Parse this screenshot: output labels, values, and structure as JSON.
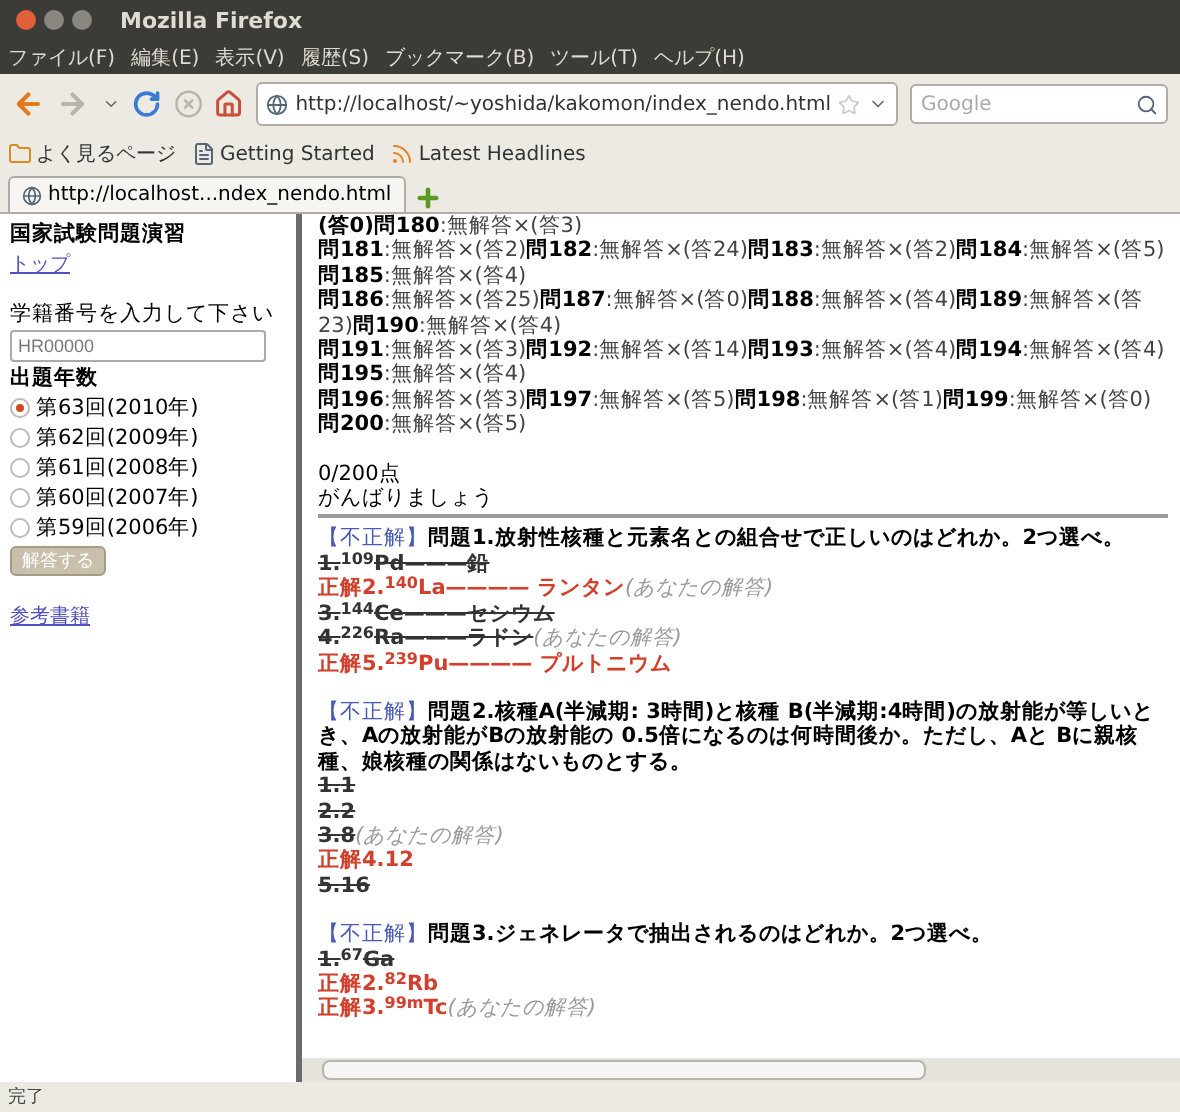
{
  "window": {
    "title": "Mozilla Firefox"
  },
  "menu": [
    "ファイル(F)",
    "編集(E)",
    "表示(V)",
    "履歴(S)",
    "ブックマーク(B)",
    "ツール(T)",
    "ヘルプ(H)"
  ],
  "navigation": {
    "url": "http://localhost/~yoshida/kakomon/index_nendo.html",
    "search_placeholder": "Google"
  },
  "bookmarks": [
    {
      "label": "よく見るページ",
      "kind": "folder"
    },
    {
      "label": "Getting Started",
      "kind": "page"
    },
    {
      "label": "Latest Headlines",
      "kind": "feed"
    }
  ],
  "tabs": [
    {
      "label": "http://localhost...ndex_nendo.html",
      "selected": true
    }
  ],
  "sidebar": {
    "title": "国家試験問題演習",
    "top_link": "トップ",
    "id_prompt": "学籍番号を入力して下さい",
    "id_value": "HR00000",
    "years_heading": "出題年数",
    "years": [
      {
        "label": "第63回(2010年)",
        "selected": true
      },
      {
        "label": "第62回(2009年)",
        "selected": false
      },
      {
        "label": "第61回(2008年)",
        "selected": false
      },
      {
        "label": "第60回(2007年)",
        "selected": false
      },
      {
        "label": "第59回(2006年)",
        "selected": false
      }
    ],
    "submit": "解答する",
    "books_link": "参考書籍"
  },
  "results": [
    [
      {
        "q": "(答0)問180",
        "r": ":無解答×",
        "a": "(答3)"
      }
    ],
    [
      {
        "q": "問181",
        "r": ":無解答×",
        "a": "(答2)"
      },
      {
        "q": "問182",
        "r": ":無解答×",
        "a": "(答24)"
      },
      {
        "q": "問183",
        "r": ":無解答×",
        "a": "(答2)"
      },
      {
        "q": "問184",
        "r": ":無解答×",
        "a": "(答5)"
      },
      {
        "q": "問185",
        "r": ":無解答×",
        "a": "(答4)"
      }
    ],
    [
      {
        "q": "問186",
        "r": ":無解答×",
        "a": "(答25)"
      },
      {
        "q": "問187",
        "r": ":無解答×",
        "a": "(答0)"
      },
      {
        "q": "問188",
        "r": ":無解答×",
        "a": "(答4)"
      },
      {
        "q": "問189",
        "r": ":無解答×",
        "a": "(答23)"
      },
      {
        "q": "問190",
        "r": ":無解答×",
        "a": "(答4)"
      }
    ],
    [
      {
        "q": "問191",
        "r": ":無解答×",
        "a": "(答3)"
      },
      {
        "q": "問192",
        "r": ":無解答×",
        "a": "(答14)"
      },
      {
        "q": "問193",
        "r": ":無解答×",
        "a": "(答4)"
      },
      {
        "q": "問194",
        "r": ":無解答×",
        "a": "(答4)"
      },
      {
        "q": "問195",
        "r": ":無解答×",
        "a": "(答4)"
      }
    ],
    [
      {
        "q": "問196",
        "r": ":無解答×",
        "a": "(答3)"
      },
      {
        "q": "問197",
        "r": ":無解答×",
        "a": "(答5)"
      },
      {
        "q": "問198",
        "r": ":無解答×",
        "a": "(答1)"
      },
      {
        "q": "問199",
        "r": ":無解答×",
        "a": "(答0)"
      },
      {
        "q": "問200",
        "r": ":無解答×",
        "a": "(答5)"
      }
    ]
  ],
  "score": "0/200点",
  "message": "がんばりましょう",
  "questions": [
    {
      "status": "【不正解】",
      "title": "問題1.放射性核種と元素名との組合せで正しいのはどれか。2つ選べ。",
      "options": [
        {
          "number": "1.",
          "text": "$^{109}$Pd———鉛",
          "correct": false,
          "struck": true
        },
        {
          "prefix": "正解",
          "number": "2.",
          "text": "$^{140}$La———— ランタン",
          "correct": true,
          "struck": false,
          "note": "(あなたの解答)"
        },
        {
          "number": "3.",
          "text": "$^{144}$Ce———セシウム",
          "correct": false,
          "struck": true
        },
        {
          "number": "4.",
          "text": "$^{226}$Ra———ラドン",
          "correct": false,
          "struck": true,
          "note": "(あなたの解答)"
        },
        {
          "prefix": "正解",
          "number": "5.",
          "text": "$^{239}$Pu———— プルトニウム",
          "correct": true,
          "struck": false
        }
      ]
    },
    {
      "status": "【不正解】",
      "title": "問題2.核種A(半減期: 3時間)と核種 B(半減期:4時間)の放射能が等しいとき、Aの放射能がBの放射能の 0.5倍になるのは何時間後か。ただし、Aと Bに親核種、娘核種の関係はないものとする。",
      "options": [
        {
          "number": "1.",
          "text": "1",
          "correct": false,
          "struck": true
        },
        {
          "number": "2.",
          "text": "2",
          "correct": false,
          "struck": true
        },
        {
          "number": "3.",
          "text": "8",
          "correct": false,
          "struck": true,
          "note": "(あなたの解答)"
        },
        {
          "prefix": "正解",
          "number": "4.",
          "text": "12",
          "correct": true,
          "struck": false
        },
        {
          "number": "5.",
          "text": "16",
          "correct": false,
          "struck": true
        }
      ]
    },
    {
      "status": "【不正解】",
      "title": "問題3.ジェネレータで抽出されるのはどれか。2つ選べ。",
      "options": [
        {
          "number": "1.",
          "text": "$^{67}$Ga",
          "correct": false,
          "struck": true
        },
        {
          "prefix": "正解",
          "number": "2.",
          "text": "$^{82}$Rb",
          "correct": true,
          "struck": false
        },
        {
          "prefix": "正解",
          "number": "3.",
          "text": "$^{99m}$Tc",
          "correct": true,
          "struck": false,
          "note": "(あなたの解答)"
        }
      ]
    }
  ],
  "status_bar": "完了"
}
